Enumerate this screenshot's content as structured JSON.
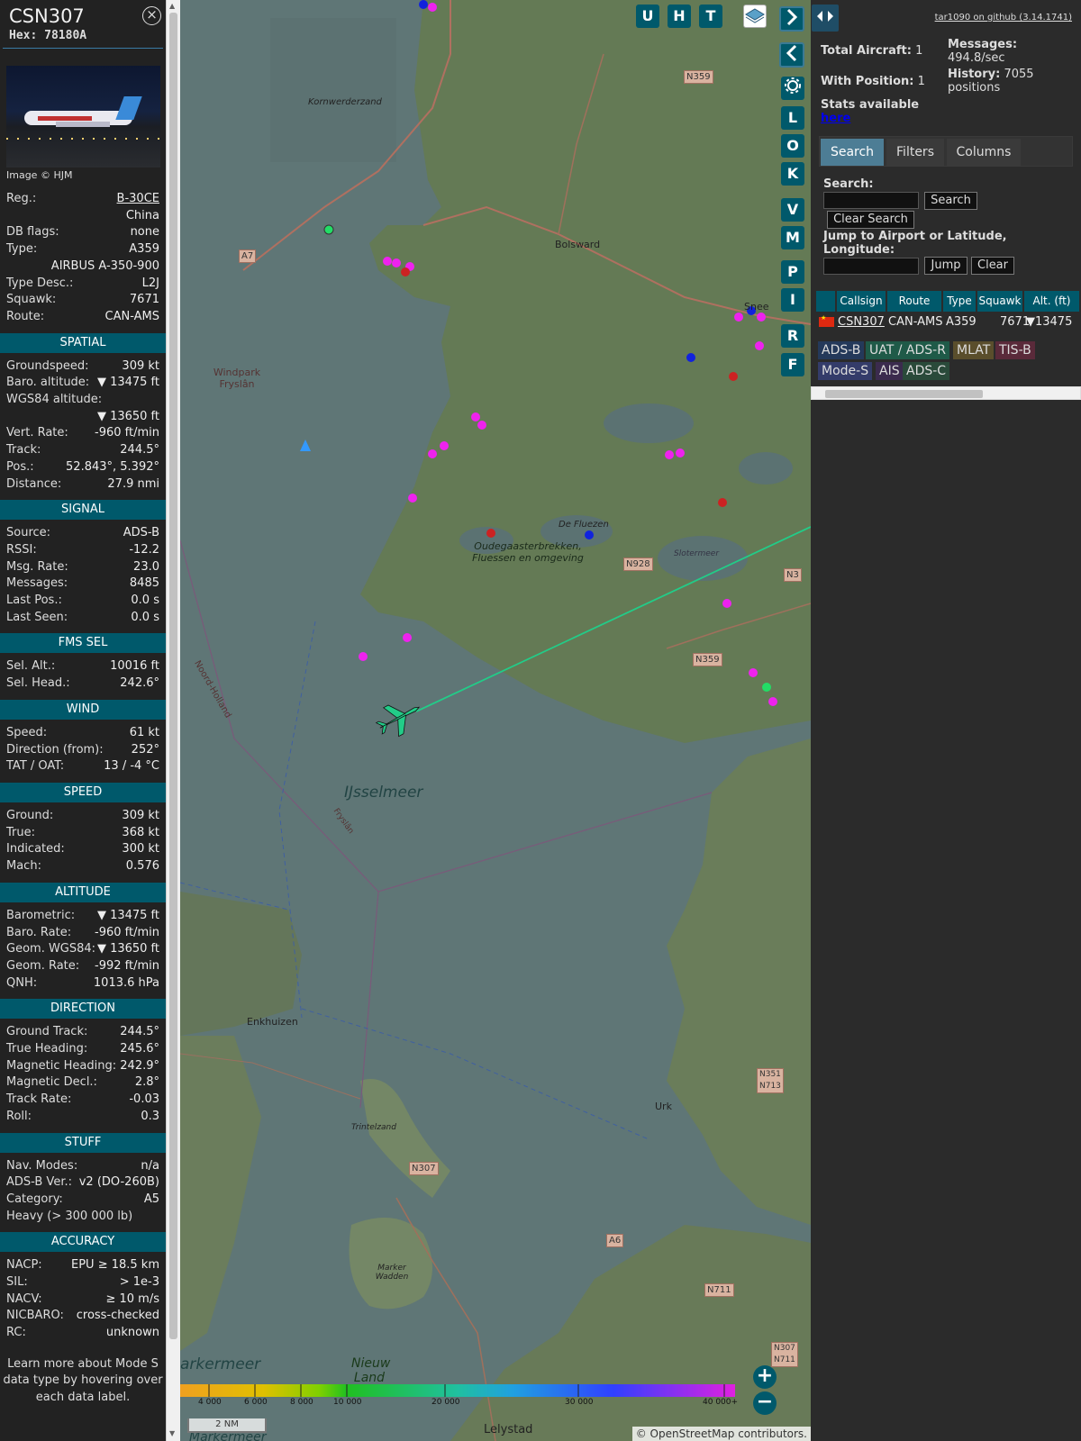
{
  "infoblock": {
    "callsign": "CSN307",
    "hex_label": "Hex:",
    "hex": "78180A",
    "close_icon": "×",
    "photo_credit": "Image © HJM",
    "details": [
      {
        "k": "Reg.:",
        "v": "B-30CE"
      },
      {
        "k": "",
        "v": "China"
      },
      {
        "k": "DB flags:",
        "v": "none"
      },
      {
        "k": "Type:",
        "v": "A359"
      },
      {
        "k": "",
        "v": "AIRBUS A-350-900"
      },
      {
        "k": "Type Desc.:",
        "v": "L2J"
      },
      {
        "k": "Squawk:",
        "v": "7671"
      },
      {
        "k": "Route:",
        "v": "CAN-AMS"
      }
    ],
    "sections": {
      "spatial": "SPATIAL",
      "signal": "SIGNAL",
      "fms": "FMS SEL",
      "wind": "WIND",
      "speed": "SPEED",
      "altitude": "ALTITUDE",
      "direction": "DIRECTION",
      "stuff": "STUFF",
      "accuracy": "ACCURACY"
    },
    "spatial": [
      {
        "k": "Groundspeed:",
        "v": "309 kt"
      },
      {
        "k": "Baro. altitude:",
        "v": "▼ 13475 ft"
      },
      {
        "k": "WGS84 altitude:",
        "v": ""
      },
      {
        "k": "",
        "v": "▼ 13650 ft"
      },
      {
        "k": "Vert. Rate:",
        "v": "-960 ft/min"
      },
      {
        "k": "Track:",
        "v": "244.5°"
      },
      {
        "k": "Pos.:",
        "v": "52.843°, 5.392°"
      },
      {
        "k": "Distance:",
        "v": "27.9 nmi"
      }
    ],
    "signal": [
      {
        "k": "Source:",
        "v": "ADS-B"
      },
      {
        "k": "RSSI:",
        "v": "-12.2"
      },
      {
        "k": "Msg. Rate:",
        "v": "23.0"
      },
      {
        "k": "Messages:",
        "v": "8485"
      },
      {
        "k": "Last Pos.:",
        "v": "0.0 s"
      },
      {
        "k": "Last Seen:",
        "v": "0.0 s"
      }
    ],
    "fms": [
      {
        "k": "Sel. Alt.:",
        "v": "10016 ft"
      },
      {
        "k": "Sel. Head.:",
        "v": "242.6°"
      }
    ],
    "wind": [
      {
        "k": "Speed:",
        "v": "61 kt"
      },
      {
        "k": "Direction (from):",
        "v": "252°"
      },
      {
        "k": "TAT / OAT:",
        "v": "13 / -4 °C"
      }
    ],
    "speed": [
      {
        "k": "Ground:",
        "v": "309 kt"
      },
      {
        "k": "True:",
        "v": "368 kt"
      },
      {
        "k": "Indicated:",
        "v": "300 kt"
      },
      {
        "k": "Mach:",
        "v": "0.576"
      }
    ],
    "altitude": [
      {
        "k": "Barometric:",
        "v": "▼ 13475 ft"
      },
      {
        "k": "Baro. Rate:",
        "v": "-960 ft/min"
      },
      {
        "k": "Geom. WGS84:",
        "v": "▼ 13650 ft"
      },
      {
        "k": "Geom. Rate:",
        "v": "-992 ft/min"
      },
      {
        "k": "QNH:",
        "v": "1013.6 hPa"
      }
    ],
    "direction": [
      {
        "k": "Ground Track:",
        "v": "244.5°"
      },
      {
        "k": "True Heading:",
        "v": "245.6°"
      },
      {
        "k": "Magnetic Heading:",
        "v": "242.9°"
      },
      {
        "k": "Magnetic Decl.:",
        "v": "2.8°"
      },
      {
        "k": "Track Rate:",
        "v": "-0.03"
      },
      {
        "k": "Roll:",
        "v": "0.3"
      }
    ],
    "stuff": [
      {
        "k": "Nav. Modes:",
        "v": "n/a"
      },
      {
        "k": "ADS-B Ver.:",
        "v": "v2 (DO-260B)"
      },
      {
        "k": "Category:",
        "v": "A5"
      },
      {
        "k": "Heavy (> 300 000 lb)",
        "v": ""
      }
    ],
    "accuracy": [
      {
        "k": "NACP:",
        "v": "EPU ≥ 18.5 km"
      },
      {
        "k": "SIL:",
        "v": "> 1e-3"
      },
      {
        "k": "NACV:",
        "v": "≥ 10 m/s"
      },
      {
        "k": "NICBARO:",
        "v": "cross-checked"
      },
      {
        "k": "RC:",
        "v": "unknown"
      }
    ],
    "learn_more": "Learn more about Mode S data type by hovering over each data label."
  },
  "map": {
    "buttons_top": [
      "U",
      "H",
      "T"
    ],
    "buttons_side": [
      "L",
      "O",
      "K",
      "V",
      "M",
      "P",
      "I",
      "R",
      "F"
    ],
    "labels": {
      "kornwerderzand": "Kornwerderzand",
      "bolsward": "Bolsward",
      "windpark": "Windpark Fryslân",
      "oudegaaster": "Oudegaasterbrekken, Fluessen en omgeving",
      "defluezen": "De Fluezen",
      "slootermeer": "Slotermeer",
      "noordholland": "Noord-Holland",
      "ijsselmeer": "IJsselmeer",
      "fryslan": "Fryslân",
      "enkhuizen": "Enkhuizen",
      "trintelzand": "Trintelzand",
      "urk": "Urk",
      "markerwadden": "Marker Wadden",
      "markermeer": "arkermeer",
      "nieuwland": "Nieuw Land",
      "lelystad": "Lelystad",
      "snee": "Snee",
      "markermeer2": "Markermeer"
    },
    "shields": [
      "N359",
      "A7",
      "N928",
      "N359",
      "N307",
      "A6",
      "N711",
      "N351 N713",
      "N307 N711",
      "N3"
    ],
    "colorbar_ticks": [
      "4 000",
      "6 000",
      "8 000",
      "10 000",
      "20 000",
      "30 000",
      "40 000+"
    ],
    "scale": "2 NM",
    "attribution": "© OpenStreetMap contributors.",
    "zoom_in": "+",
    "zoom_out": "−"
  },
  "right": {
    "github": "tar1090 on github (3.14.1741)",
    "total_aircraft_label": "Total Aircraft:",
    "total_aircraft": "1",
    "with_position_label": "With Position:",
    "with_position": "1",
    "messages_label": "Messages:",
    "messages": "494.8/sec",
    "history_label": "History:",
    "history": "7055 positions",
    "stats_available": "Stats available",
    "stats_link": "here",
    "tabs": [
      "Search",
      "Filters",
      "Columns"
    ],
    "search_label": "Search:",
    "search_button": "Search",
    "clear_search": "Clear Search",
    "jump_label": "Jump to Airport or Latitude, Longitude:",
    "jump_button": "Jump",
    "clear_button": "Clear",
    "table_headers": [
      "Callsign",
      "Route",
      "Type",
      "Squawk",
      "Alt. (ft)"
    ],
    "row": {
      "callsign": "CSN307",
      "route": "CAN-AMS",
      "type": "A359",
      "squawk": "7671",
      "alt": "▼13475"
    },
    "sources": [
      {
        "label": "ADS-B",
        "color": "#24395a"
      },
      {
        "label": "UAT / ADS-R",
        "color": "#1f5a48"
      },
      {
        "label": "MLAT",
        "color": "#5a4e2c"
      },
      {
        "label": "TIS-B",
        "color": "#5a2a3a"
      },
      {
        "label": "Mode-S",
        "color": "#343c6a"
      },
      {
        "label": "AIS",
        "color": "#3b2b4e"
      },
      {
        "label": "ADS-C",
        "color": "#2a4a3a"
      }
    ]
  }
}
